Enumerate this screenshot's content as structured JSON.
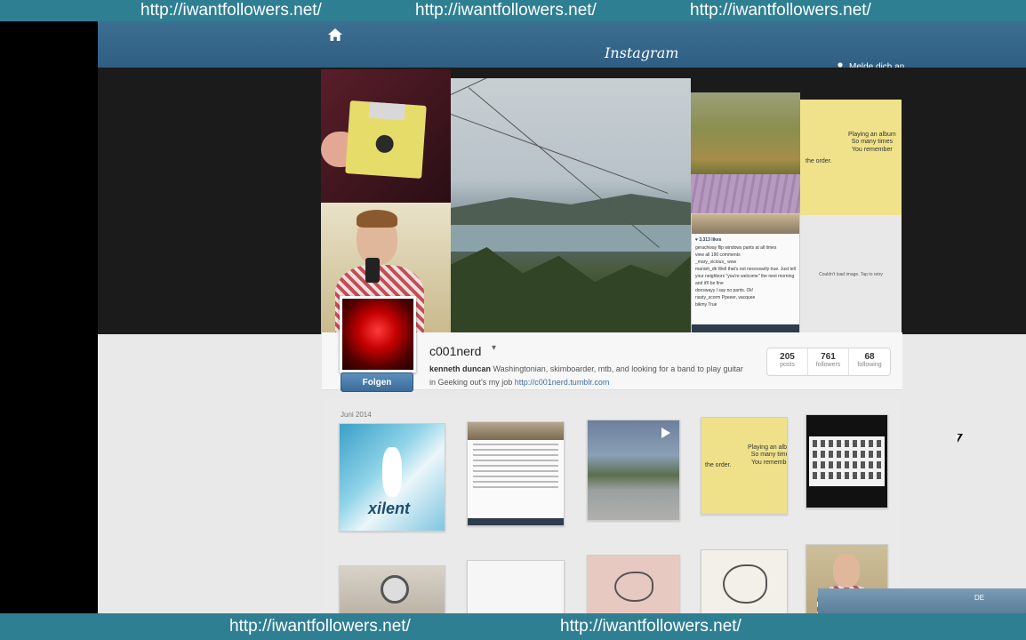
{
  "watermark": {
    "top": [
      "http://iwantfollowers.net/",
      "http://iwantfollowers.net/",
      "http://iwantfollowers.net/"
    ],
    "bottom": [
      "http://iwantfollowers.net/",
      "http://iwantfollowers.net/"
    ]
  },
  "nav": {
    "logo": "Instagram",
    "login_label": "Melde dich an"
  },
  "cover": {
    "note_text": "Playing an album\nSo many times\nYou remember",
    "note_left": "the order.",
    "post_likes": "♥ 3,313 likes",
    "post_lines": [
      "gerachway flip windows pants at all times",
      "view all 190 comments",
      "_mary_vicious_ wow",
      "manish_dk Well that's not necessarily true. Just tell",
      "your neighbors \"you're welcome\" the next morning",
      "and it'll be fine",
      "donswayy I say no pants. Ok!",
      "nasty_scorm Ppeeer, vacquee",
      "bikmy True"
    ],
    "grey_text": "Couldn't load image. Tap to retry"
  },
  "profile": {
    "follow_label": "Folgen",
    "username": "c001nerd",
    "caret": "▾",
    "full_name": "kenneth duncan",
    "bio": " Washingtonian, skimboarder, mtb, and looking for a band to play guitar in Geeking out's my job ",
    "url": "http://c001nerd.tumblr.com",
    "stats": [
      {
        "value": "205",
        "label": "posts"
      },
      {
        "value": "761",
        "label": "followers"
      },
      {
        "value": "68",
        "label": "following"
      }
    ]
  },
  "feed": {
    "month": "Juni 2014",
    "xilent_word": "xilent",
    "note_text": "Playing an album\nSo many times\nYou remember",
    "note_left": "the order."
  },
  "system": {
    "lang": "DE"
  },
  "colors": {
    "banner": "#2f7f93",
    "nav": "#3c6f92",
    "follow_button": "#4a7cab",
    "link": "#3d6fa0"
  }
}
